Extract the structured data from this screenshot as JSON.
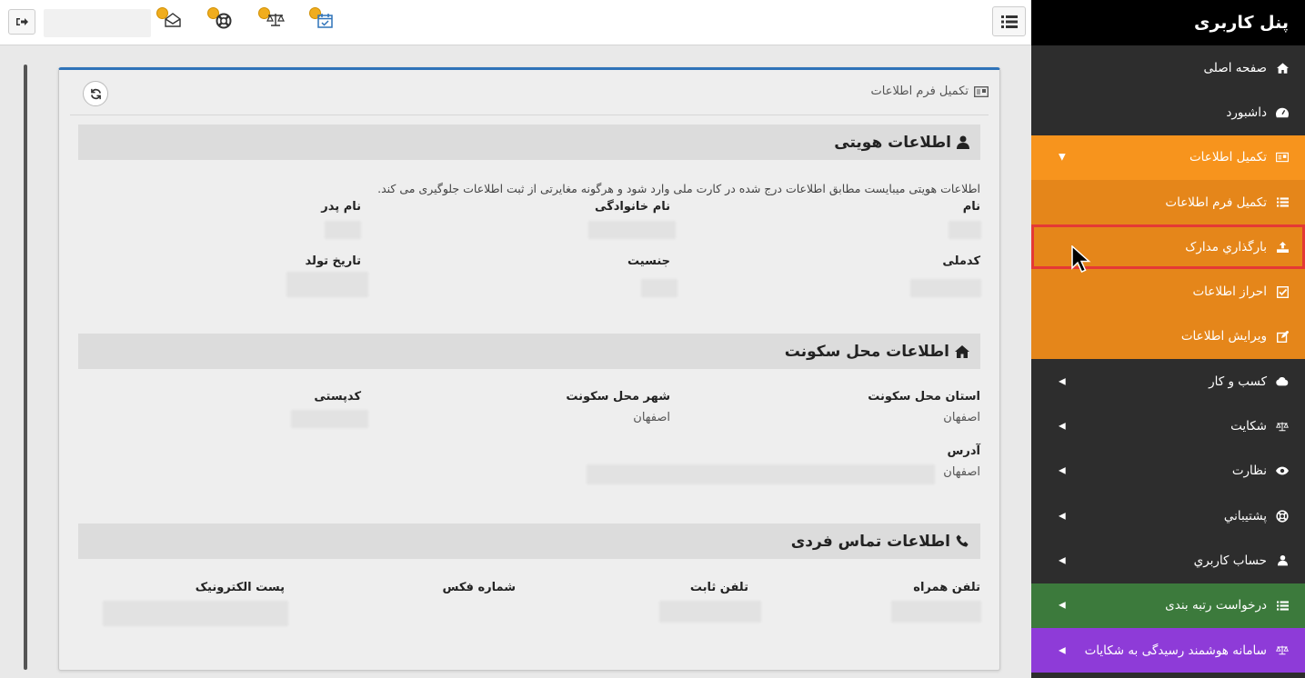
{
  "sidebar": {
    "title": "پنل کاربری",
    "items": [
      {
        "label": "صفحه اصلی",
        "icon": "home-icon"
      },
      {
        "label": "داشبورد",
        "icon": "dashboard-icon"
      },
      {
        "label": "تکمیل اطلاعات",
        "icon": "id-card-icon",
        "expanded": true
      },
      {
        "label": "تکمیل فرم اطلاعات",
        "icon": "list-icon"
      },
      {
        "label": "بارگذاري مدارک",
        "icon": "upload-icon",
        "highlighted": true
      },
      {
        "label": "احراز اطلاعات",
        "icon": "check-square-icon"
      },
      {
        "label": "ویرایش اطلاعات",
        "icon": "edit-icon"
      },
      {
        "label": "کسب و کار",
        "icon": "cloud-icon"
      },
      {
        "label": "شکایت",
        "icon": "scale-icon"
      },
      {
        "label": "نظارت",
        "icon": "eye-icon"
      },
      {
        "label": "پشتيباني",
        "icon": "lifebuoy-icon"
      },
      {
        "label": "حساب کاربري",
        "icon": "user-icon"
      },
      {
        "label": "درخواست رتبه بندی",
        "icon": "list-icon"
      },
      {
        "label": "سامانه هوشمند رسیدگی به شکایات",
        "icon": "scale-icon"
      }
    ],
    "colors": {
      "orange": "#f7941d",
      "green": "#3c7a3c",
      "purple": "#8e3bd8",
      "dark": "#2d2d2d"
    }
  },
  "panel": {
    "title": "تکمیل فرم اطلاعات"
  },
  "identity": {
    "heading": "اطلاعات هویتی",
    "note": "اطلاعات هویتی میبایست مطابق اطلاعات درج شده در کارت ملی وارد شود و هرگونه مغایرتی از ثبت اطلاعات جلوگیری می کند.",
    "first_name": "نام",
    "last_name": "نام خانوادگی",
    "father_name": "نام پدر",
    "national_code": "کدملی",
    "gender": "جنسیت",
    "birth_date": "تاریخ تولد"
  },
  "residence": {
    "heading": "اطلاعات محل سکونت",
    "province_label": "استان محل سکونت",
    "province_value": "اصفهان",
    "city_label": "شهر محل سکونت",
    "city_value": "اصفهان",
    "postal_label": "کدپستی",
    "address_label": "آدرس",
    "address_value": "اصفهان"
  },
  "contact": {
    "heading": "اطلاعات تماس فردی",
    "mobile": "تلفن همراه",
    "phone": "تلفن ثابت",
    "fax": "شماره فکس",
    "email": "پست الکترونیک"
  }
}
